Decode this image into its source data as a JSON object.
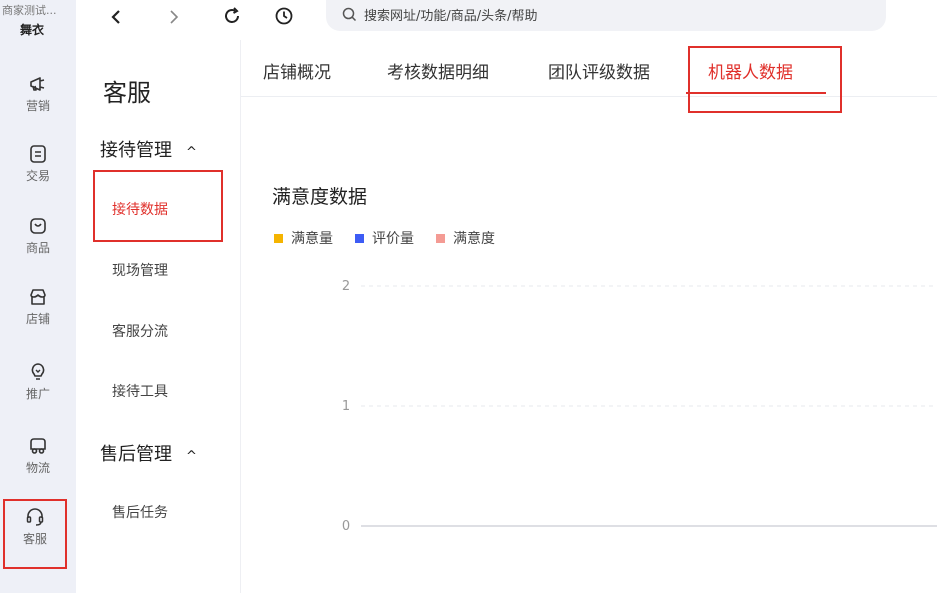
{
  "rail": {
    "shop_name": "商家测试...",
    "shop_sub": "舞衣",
    "items": [
      {
        "label": "营销",
        "icon": "megaphone-icon"
      },
      {
        "label": "交易",
        "icon": "document-icon"
      },
      {
        "label": "商品",
        "icon": "bag-icon"
      },
      {
        "label": "店铺",
        "icon": "store-icon"
      },
      {
        "label": "推广",
        "icon": "lightbulb-icon"
      },
      {
        "label": "物流",
        "icon": "truck-icon"
      },
      {
        "label": "客服",
        "icon": "headset-icon"
      }
    ]
  },
  "topbar": {
    "search_placeholder": "搜索网址/功能/商品/头条/帮助"
  },
  "sidebar": {
    "title": "客服",
    "groups": [
      {
        "label": "接待管理",
        "items": [
          "接待数据",
          "现场管理",
          "客服分流",
          "接待工具"
        ]
      },
      {
        "label": "售后管理",
        "items": [
          "售后任务"
        ]
      }
    ]
  },
  "tabs": [
    "店铺概况",
    "考核数据明细",
    "团队评级数据",
    "机器人数据"
  ],
  "section": {
    "title": "满意度数据"
  },
  "chart_data": {
    "type": "line",
    "title": "满意度数据",
    "series": [
      {
        "name": "满意量",
        "color": "#f5b400",
        "values": []
      },
      {
        "name": "评价量",
        "color": "#3d5cf5",
        "values": []
      },
      {
        "name": "满意度",
        "color": "#f49b94",
        "values": []
      }
    ],
    "y_ticks": [
      "2",
      "1",
      "0"
    ],
    "ylim": [
      0,
      2
    ],
    "grid": true,
    "legend_position": "top-left"
  },
  "colors": {
    "accent": "#e0302b",
    "rail_bg": "#eef0f7"
  }
}
